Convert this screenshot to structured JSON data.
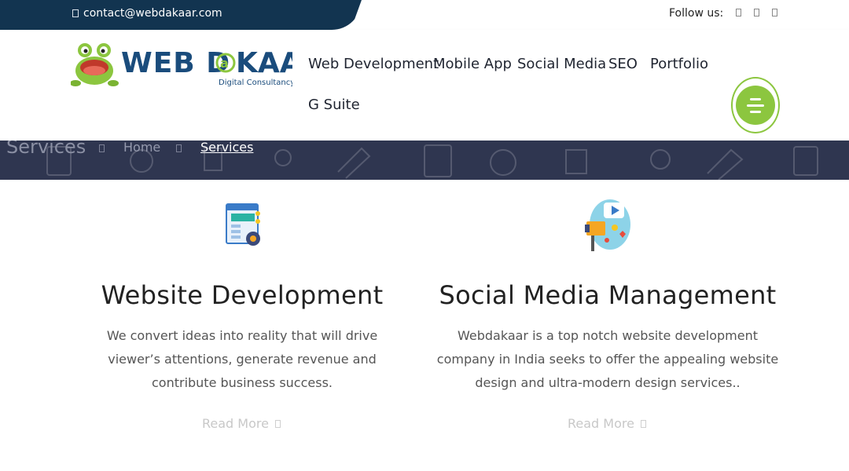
{
  "topbar": {
    "email": "contact@webdakaar.com",
    "follow_label": "Follow us:",
    "social_icons": [
      "facebook-icon",
      "twitter-icon",
      "linkedin-icon"
    ],
    "bg_color": "#123450"
  },
  "logo": {
    "text": "WEB D@KAAR",
    "tagline": "Digital Consultancy",
    "primary_color": "#1a4c7c",
    "accent_color": "#8cc63f"
  },
  "nav": {
    "items": [
      "Web Development",
      "Mobile App",
      "Social Media",
      "SEO",
      "Portfolio",
      "G Suite"
    ]
  },
  "menu_button": {
    "icon": "hamburger-icon",
    "color": "#8cc63f"
  },
  "breadcrumb": {
    "title": "Services",
    "items": [
      "Home",
      "Services"
    ],
    "bg_color": "#2f3650"
  },
  "services": [
    {
      "icon": "website-development-icon",
      "title": "Website Development",
      "description": "We convert ideas into reality that will drive viewer’s attentions, generate revenue and contribute business success.",
      "cta": "Read More"
    },
    {
      "icon": "social-media-icon",
      "title": "Social Media Management",
      "description": "Webdakaar is a top notch website development company in India seeks to offer the appealing website design and ultra-modern design services..",
      "cta": "Read More"
    }
  ]
}
